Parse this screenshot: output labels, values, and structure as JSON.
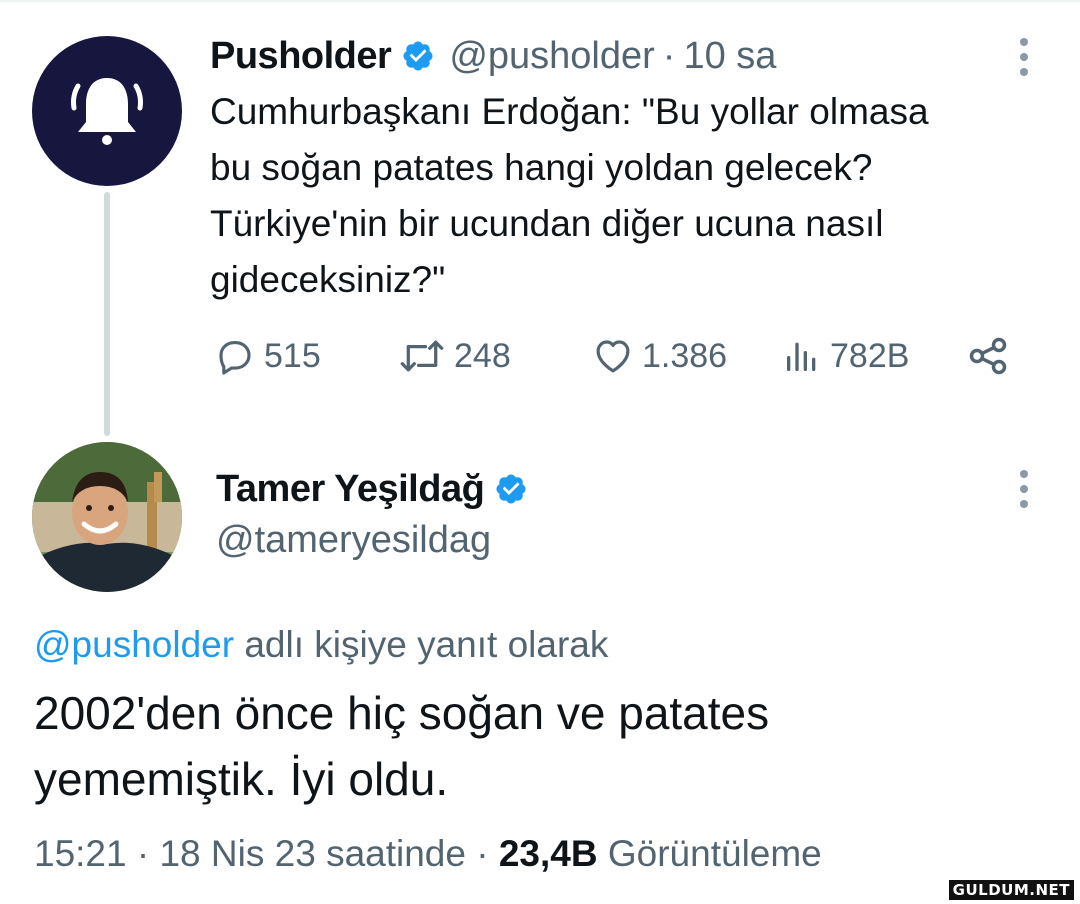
{
  "tweet1": {
    "author_name": "Pusholder",
    "handle": "@pusholder",
    "separator": "·",
    "time_ago": "10 sa",
    "text": "Cumhurbaşkanı Erdoğan: \"Bu yollar olmasa\nbu soğan patates hangi yoldan gelecek?\nTürkiye'nin bir ucundan diğer ucuna nasıl\ngideceksiniz?\"",
    "avatar_icon": "bell-icon",
    "stats": {
      "replies": "515",
      "retweets": "248",
      "likes": "1.386",
      "views": "782B"
    }
  },
  "tweet2": {
    "author_name": "Tamer Yeşildağ",
    "handle": "@tameryesildag",
    "reply_to_handle": "@pusholder",
    "reply_to_suffix": " adlı kişiye yanıt olarak",
    "text": "2002'den önce hiç soğan ve patates\nyememiştik. İyi oldu.",
    "meta": {
      "time": "15:21",
      "sep1": " · ",
      "date": "18 Nis 23 saatinde",
      "sep2": " · ",
      "views_count": "23,4B",
      "views_label": " Görüntüleme"
    }
  },
  "watermark": "GULDUM.NET",
  "colors": {
    "verified_blue": "#1d9bf0",
    "link_blue": "#1d9bf0",
    "muted_gray": "#536471",
    "avatar_navy": "#16163f"
  }
}
